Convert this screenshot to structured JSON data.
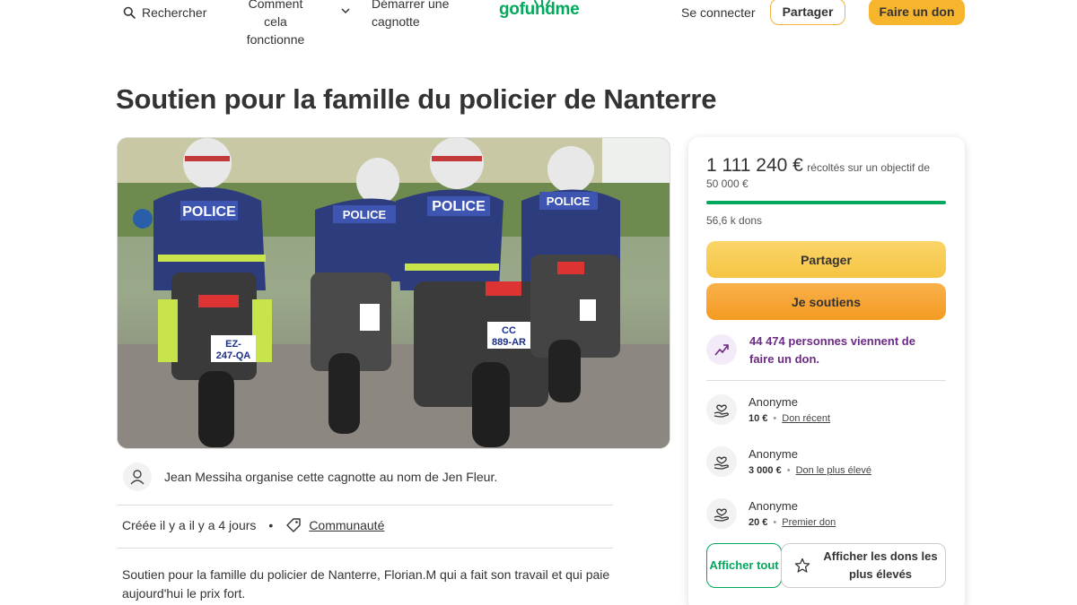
{
  "header": {
    "search_label": "Rechercher",
    "how_it_works": "Comment cela fonctionne",
    "start_campaign": "Démarrer une cagnotte",
    "logo_text": "gofundme",
    "login": "Se connecter",
    "share": "Partager",
    "donate": "Faire un don"
  },
  "page": {
    "title": "Soutien pour la famille du policier de Nanterre",
    "hero_image_alt": "police-motorcycles-photo"
  },
  "organizer": {
    "text": "Jean Messiha organise cette cagnotte au nom de Jen Fleur."
  },
  "meta": {
    "created": "Créée il y a il y a 4 jours",
    "category": "Communauté"
  },
  "description": "Soutien pour la famille du policier de Nanterre, Florian.M qui a fait son travail et qui paie aujourd'hui le prix fort.",
  "card": {
    "raised_amount": "1 111 240 €",
    "raised_text": "récoltés sur un objectif de",
    "goal": "50 000 €",
    "progress_fraction": 1.0,
    "donations_count": "56,6 k dons",
    "share_button": "Partager",
    "support_button": "Je soutiens",
    "trend_text": "44 474 personnes viennent de faire un don.",
    "donations": [
      {
        "name": "Anonyme",
        "amount": "10 €",
        "label": "Don récent"
      },
      {
        "name": "Anonyme",
        "amount": "3 000 €",
        "label": "Don le plus élevé"
      },
      {
        "name": "Anonyme",
        "amount": "20 €",
        "label": "Premier don"
      }
    ],
    "show_all_button": "Afficher tout",
    "show_top_button": "Afficher les dons les plus élevés"
  },
  "colors": {
    "brand_green": "#02a95c",
    "button_yellow": "#f7b52e",
    "button_orange": "#f49b22",
    "trend_purple": "#6b2a83"
  },
  "icons": [
    "search-icon",
    "chevron-down-icon",
    "user-icon",
    "tag-icon",
    "trend-up-icon",
    "heart-hand-icon",
    "star-icon"
  ]
}
